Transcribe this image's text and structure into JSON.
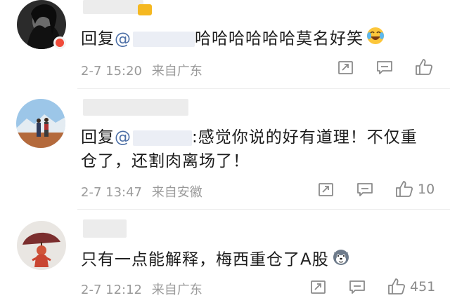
{
  "comments": [
    {
      "reply_prefix": "回复",
      "at_sign": "@",
      "text_line1": "哈哈哈哈哈哈莫名好笑",
      "text_line2": "",
      "time": "2-7 15:20",
      "location": "来自广东",
      "like_count": "",
      "emoji": "laughing-tears-emoji"
    },
    {
      "reply_prefix": "回复",
      "at_sign": "@",
      "text_line1": ":感觉你说的好有道理！不仅重",
      "text_line2": "仓了，还割肉离场了！",
      "time": "2-7 13:47",
      "location": "来自安徽",
      "like_count": "10"
    },
    {
      "reply_prefix": "",
      "at_sign": "",
      "text_line1": "只有一点能解释，梅西重仓了A股",
      "text_line2": "",
      "time": "2-7 12:12",
      "location": "来自广东",
      "like_count": "451",
      "emoji": "husky-emoji"
    }
  ],
  "icons": {
    "share": "share-icon",
    "comment": "comment-icon",
    "like": "thumbs-up-icon"
  },
  "colors": {
    "text": "#1c1c1c",
    "meta": "#9a9a9a",
    "icon": "#8a8a8a"
  }
}
